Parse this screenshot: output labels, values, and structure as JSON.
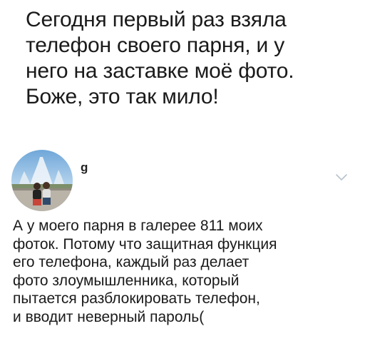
{
  "headline": {
    "lines": [
      "Сегодня первый раз взяла",
      "телефон своего парня, и у",
      "него на заставке моё фото.",
      "Боже, это так мило!"
    ]
  },
  "post": {
    "username": "g",
    "avatar_icon": "profile-photo-couple",
    "menu_icon": "chevron-down-icon",
    "body_lines": [
      "А у моего парня в галерее 811 моих",
      "фоток. Потому что защитная функция",
      "его телефона, каждый раз делает",
      "фото злоумышленника, который",
      "пытается разблокировать телефон,",
      "и вводит неверный пароль("
    ]
  },
  "colors": {
    "text": "#1a1a1a",
    "chevron": "#b8c2cc",
    "background": "#ffffff"
  }
}
